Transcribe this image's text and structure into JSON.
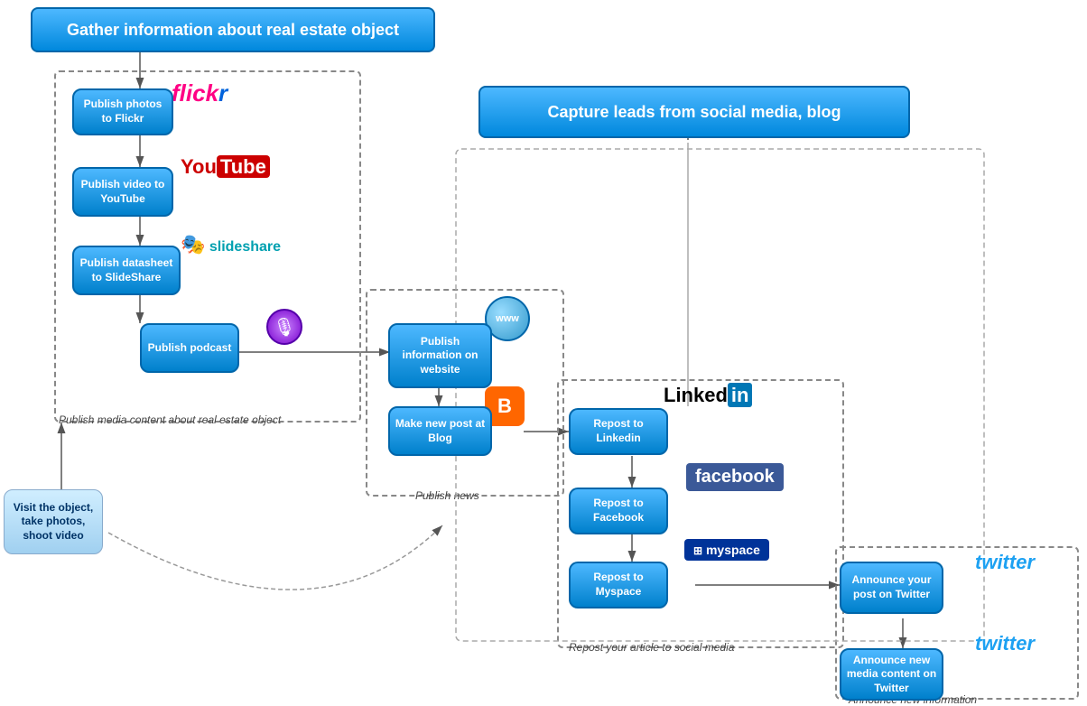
{
  "title": "Gather information about real estate object",
  "capture_leads": "Capture leads from social media, blog",
  "nodes": {
    "publish_flickr": "Publish photos to Flickr",
    "publish_youtube": "Publish video to YouTube",
    "publish_slideshare": "Publish datasheet to SlideShare",
    "publish_podcast": "Publish podcast",
    "publish_website": "Publish information on website",
    "make_blog_post": "Make new post at Blog",
    "repost_linkedin": "Repost to Linkedin",
    "repost_facebook": "Repost to Facebook",
    "repost_myspace": "Repost to Myspace",
    "announce_twitter": "Announce your post on Twitter",
    "announce_new_twitter": "Announce new media content on Twitter",
    "visit_object": "Visit the object, take photos, shoot video"
  },
  "labels": {
    "publish_media": "Publish media content about real estate object",
    "publish_news": "Publish news",
    "repost_social": "Repost your article to social media",
    "announce_new_info": "Announce new information"
  },
  "logos": {
    "flickr": "flickr",
    "youtube": "YouTube",
    "slideshare": "slideshare",
    "linkedin_text": "Linked",
    "linkedin_in": "in",
    "facebook": "facebook",
    "myspace": "myspace",
    "twitter": "twitter"
  }
}
